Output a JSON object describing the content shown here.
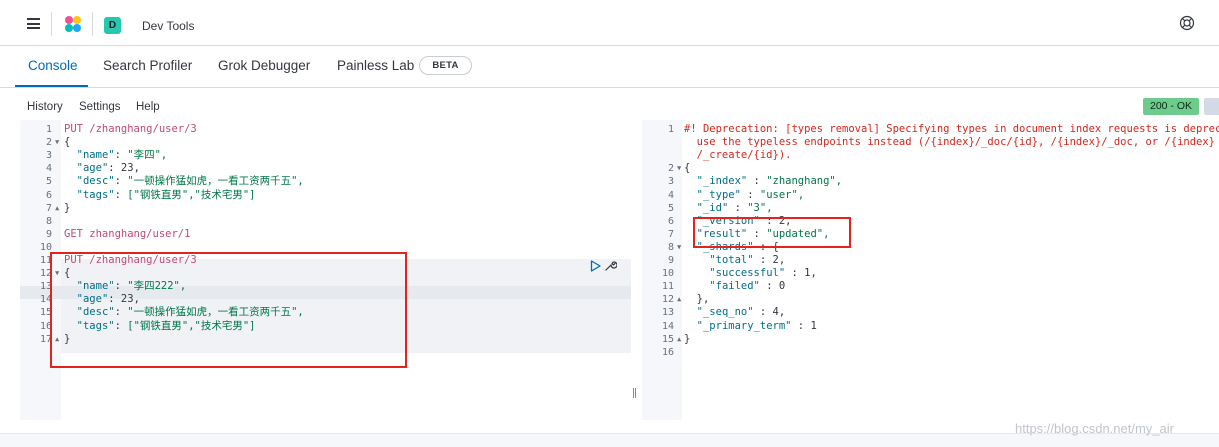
{
  "header": {
    "space_letter": "D",
    "app_title": "Dev Tools"
  },
  "tabs": [
    {
      "label": "Console"
    },
    {
      "label": "Search Profiler"
    },
    {
      "label": "Grok Debugger"
    },
    {
      "label": "Painless Lab"
    }
  ],
  "beta_label": "BETA",
  "menu": {
    "history": "History",
    "settings": "Settings",
    "help": "Help"
  },
  "status_badge": "200 - OK",
  "request_lines": [
    {
      "n": "1",
      "text": "PUT /zhanghang/user/3"
    },
    {
      "n": "2",
      "text": "{"
    },
    {
      "n": "3",
      "key": "\"name\"",
      "val": "\"李四\","
    },
    {
      "n": "4",
      "key": "\"age\"",
      "val": "23,"
    },
    {
      "n": "5",
      "key": "\"desc\"",
      "val": "\"一顿操作猛如虎，一看工资两千五\","
    },
    {
      "n": "6",
      "key": "\"tags\"",
      "val": "[\"钢铁直男\",\"技术宅男\"]"
    },
    {
      "n": "7",
      "text": "}"
    },
    {
      "n": "8",
      "text": ""
    },
    {
      "n": "9",
      "text": "GET zhanghang/user/1"
    },
    {
      "n": "10",
      "text": ""
    },
    {
      "n": "11",
      "text": "PUT /zhanghang/user/3"
    },
    {
      "n": "12",
      "text": "{"
    },
    {
      "n": "13",
      "key": "\"name\"",
      "val": "\"李四222\","
    },
    {
      "n": "14",
      "key": "\"age\"",
      "val": "23,"
    },
    {
      "n": "15",
      "key": "\"desc\"",
      "val": "\"一顿操作猛如虎，一看工资两千五\","
    },
    {
      "n": "16",
      "key": "\"tags\"",
      "val": "[\"钢铁直男\",\"技术宅男\"]"
    },
    {
      "n": "17",
      "text": "}"
    }
  ],
  "response_lines": [
    {
      "n": "1",
      "text": "#! Deprecation: [types removal] Specifying types in document index requests is deprecated,"
    },
    {
      "n": "",
      "text": "use the typeless endpoints instead (/{index}/_doc/{id}, /{index}/_doc, or /{index}"
    },
    {
      "n": "",
      "text": "/_create/{id})."
    },
    {
      "n": "2",
      "text": "{"
    },
    {
      "n": "3",
      "key": "\"_index\"",
      "val": "\"zhanghang\","
    },
    {
      "n": "4",
      "key": "\"_type\"",
      "val": "\"user\","
    },
    {
      "n": "5",
      "key": "\"_id\"",
      "val": "\"3\","
    },
    {
      "n": "6",
      "key": "\"_version\"",
      "val": "2,"
    },
    {
      "n": "7",
      "key": "\"result\"",
      "val": "\"updated\","
    },
    {
      "n": "8",
      "key": "\"_shards\"",
      "val": "{"
    },
    {
      "n": "9",
      "key": "\"total\"",
      "val": "2,"
    },
    {
      "n": "10",
      "key": "\"successful\"",
      "val": "1,"
    },
    {
      "n": "11",
      "key": "\"failed\"",
      "val": "0"
    },
    {
      "n": "12",
      "text": "},"
    },
    {
      "n": "13",
      "key": "\"_seq_no\"",
      "val": "4,"
    },
    {
      "n": "14",
      "key": "\"_primary_term\"",
      "val": "1"
    },
    {
      "n": "15",
      "text": "}"
    },
    {
      "n": "16",
      "text": ""
    }
  ],
  "watermark": "https://blog.csdn.net/my_air",
  "colors": {
    "accent": "#006bb8",
    "status_ok": "#6dcc8b",
    "annotation": "#e3231c"
  }
}
